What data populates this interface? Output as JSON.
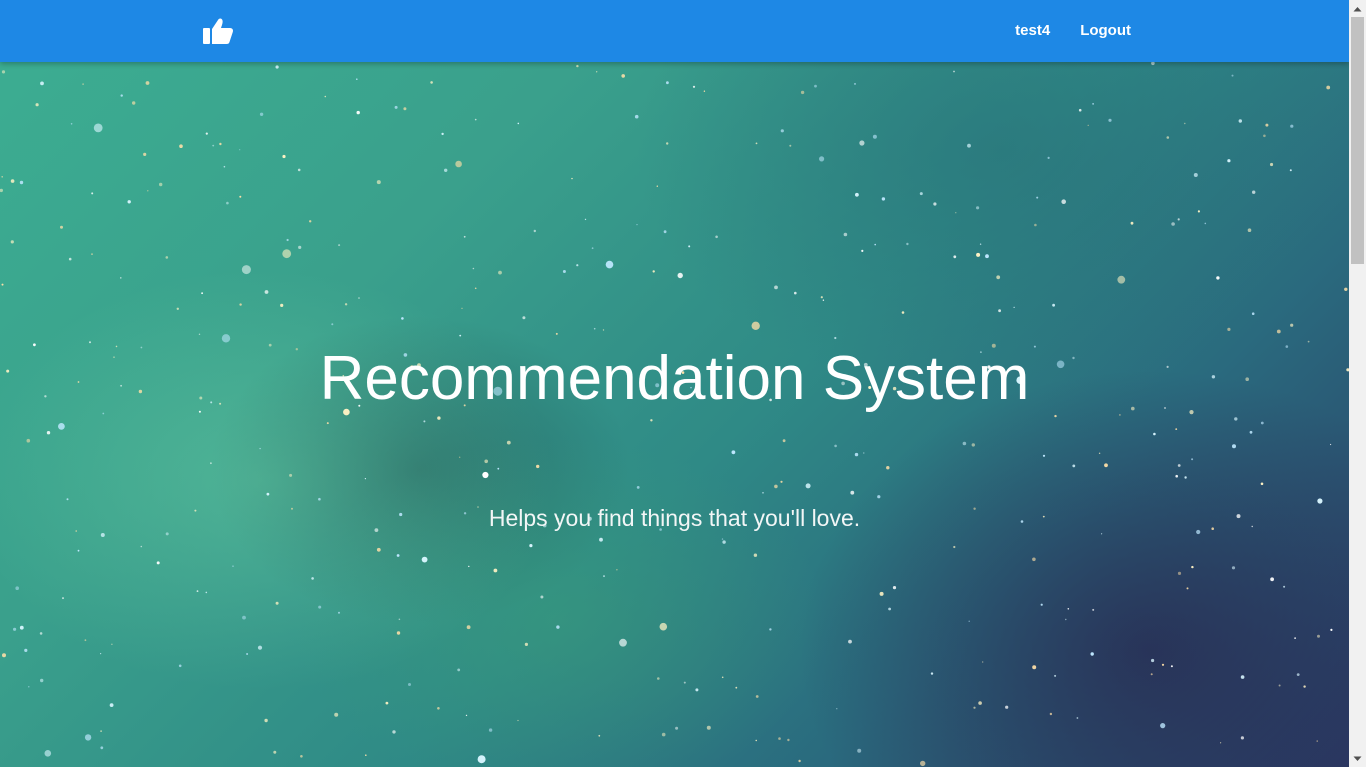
{
  "navbar": {
    "background_color": "#1e88e5",
    "logo_icon": "thumbs-up-icon",
    "links": [
      {
        "label": "test4"
      },
      {
        "label": "Logout"
      }
    ]
  },
  "hero": {
    "title": "Recommendation System",
    "subtitle": "Helps you find things that you'll love."
  },
  "scrollbar": {
    "up_icon": "scroll-up-arrow-icon",
    "down_icon": "scroll-down-arrow-icon"
  }
}
